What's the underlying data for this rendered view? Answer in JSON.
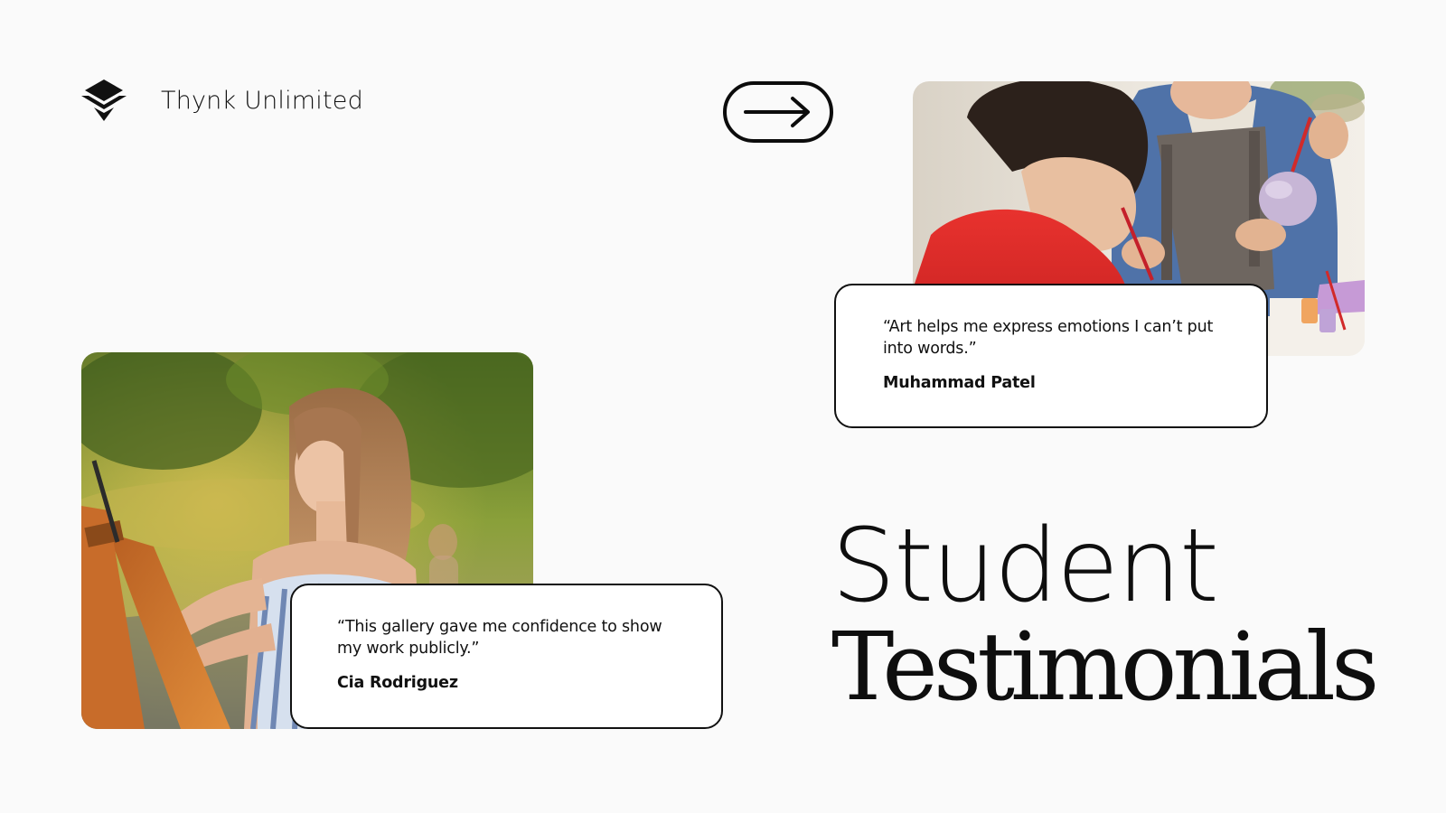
{
  "brand": {
    "name": "Thynk Unlimited",
    "logo_icon": "layered-diamond-logo"
  },
  "navigation": {
    "next_icon": "arrow-right-icon"
  },
  "title": {
    "line1": "Student",
    "line2": "Testimonials"
  },
  "testimonials": [
    {
      "quote": "“Art helps me express emotions I can’t put into words.”",
      "author": "Muhammad Patel",
      "photo": "child-painting-clay-photo"
    },
    {
      "quote": " “This gallery gave me confidence to show my work publicly.”",
      "author": "Cia Rodriguez",
      "photo": "girl-painting-easel-photo"
    }
  ],
  "colors": {
    "background": "#fafafa",
    "ink": "#111111",
    "card": "#ffffff"
  }
}
